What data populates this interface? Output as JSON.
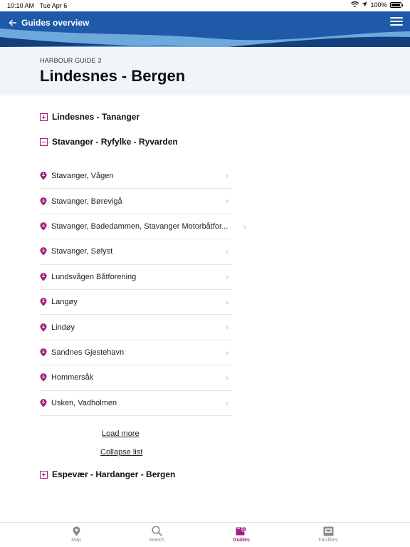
{
  "status_bar": {
    "time": "10:10 AM",
    "date": "Tue Apr 6",
    "battery": "100%"
  },
  "header": {
    "title": "Guides overview"
  },
  "guide": {
    "subtitle": "HARBOUR GUIDE 3",
    "title": "Lindesnes - Bergen"
  },
  "sections": [
    {
      "label": "Lindesnes - Tananger",
      "expanded": false
    },
    {
      "label": "Stavanger - Ryfylke - Ryvarden",
      "expanded": true
    },
    {
      "label": "Espevær - Hardanger - Bergen",
      "expanded": false
    }
  ],
  "harbours": [
    {
      "label": "Stavanger, Vågen"
    },
    {
      "label": "Stavanger, Børevigå"
    },
    {
      "label": "Stavanger, Badedammen, Stavanger Motorbåtfor..."
    },
    {
      "label": "Stavanger, Sølyst"
    },
    {
      "label": "Lundsvågen Båtforening"
    },
    {
      "label": "Langøy"
    },
    {
      "label": "Lindøy"
    },
    {
      "label": "Sandnes Gjestehavn"
    },
    {
      "label": "Hommersåk"
    },
    {
      "label": "Usken, Vadholmen"
    }
  ],
  "actions": {
    "load_more": "Load more",
    "collapse_list": "Collapse list"
  },
  "tabs": [
    {
      "label": "Map",
      "icon": "map-pin-icon"
    },
    {
      "label": "Search",
      "icon": "search-icon"
    },
    {
      "label": "Guides",
      "icon": "book-icon"
    },
    {
      "label": "Facilities",
      "icon": "facilities-icon"
    }
  ],
  "colors": {
    "accent": "#a21f7a",
    "header_blue": "#1f5aa8",
    "wave_light": "#6fa8dc",
    "wave_dark": "#123f7e"
  }
}
